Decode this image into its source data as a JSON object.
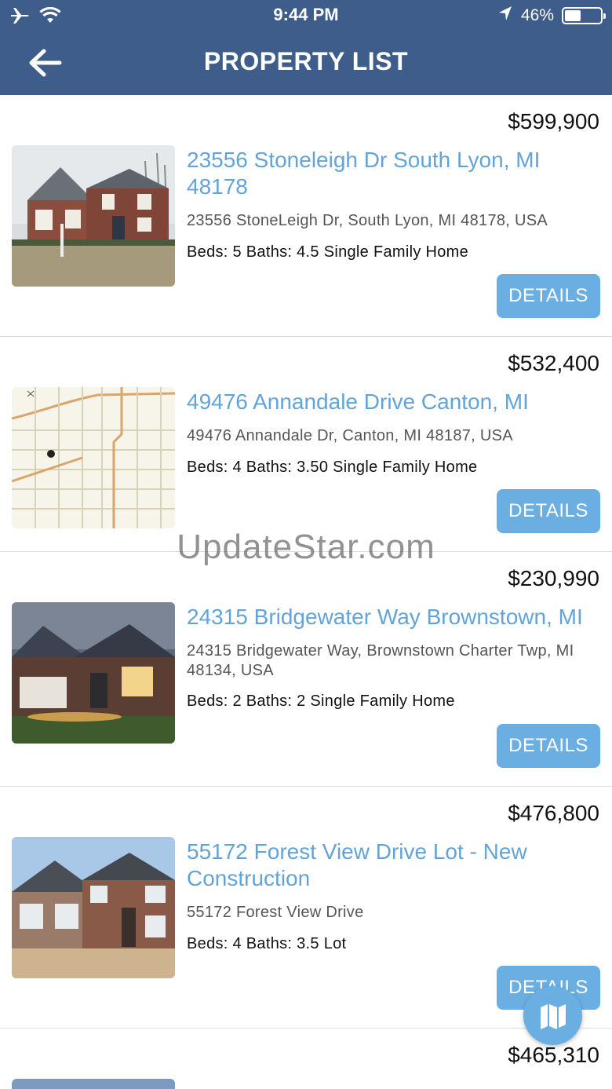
{
  "status_bar": {
    "time": "9:44 PM",
    "battery_percent": "46%",
    "battery_level": 0.46,
    "icons": [
      "airplane-icon",
      "wifi-icon",
      "location-arrow-icon",
      "battery-icon"
    ]
  },
  "nav": {
    "title": "PROPERTY LIST",
    "back_icon": "arrow-left-icon"
  },
  "colors": {
    "header": "#3f5d8a",
    "link": "#62a4da",
    "button": "#6aaee2"
  },
  "properties": [
    {
      "price": "$599,900",
      "title": "23556 Stoneleigh Dr South Lyon, MI 48178",
      "address": "23556 StoneLeigh Dr, South Lyon, MI 48178, USA",
      "specs": "Beds: 5 Baths: 4.5 Single Family Home",
      "button": "DETAILS"
    },
    {
      "price": "$532,400",
      "title": "49476 Annandale Drive Canton, MI",
      "address": "49476 Annandale Dr, Canton, MI 48187, USA",
      "specs": "Beds: 4 Baths: 3.50 Single Family Home",
      "button": "DETAILS"
    },
    {
      "price": "$230,990",
      "title": "24315 Bridgewater Way Brownstown, MI",
      "address": "24315 Bridgewater Way, Brownstown Charter Twp, MI 48134, USA",
      "specs": "Beds: 2 Baths: 2 Single Family Home",
      "button": "DETAILS"
    },
    {
      "price": "$476,800",
      "title": "55172 Forest View Drive Lot - New Construction",
      "address": "55172 Forest View Drive",
      "specs": "Beds: 4 Baths: 3.5 Lot",
      "button": "DETAILS"
    },
    {
      "price": "$465,310"
    }
  ],
  "watermark": "UpdateStar.com",
  "fab_icon": "map-icon"
}
